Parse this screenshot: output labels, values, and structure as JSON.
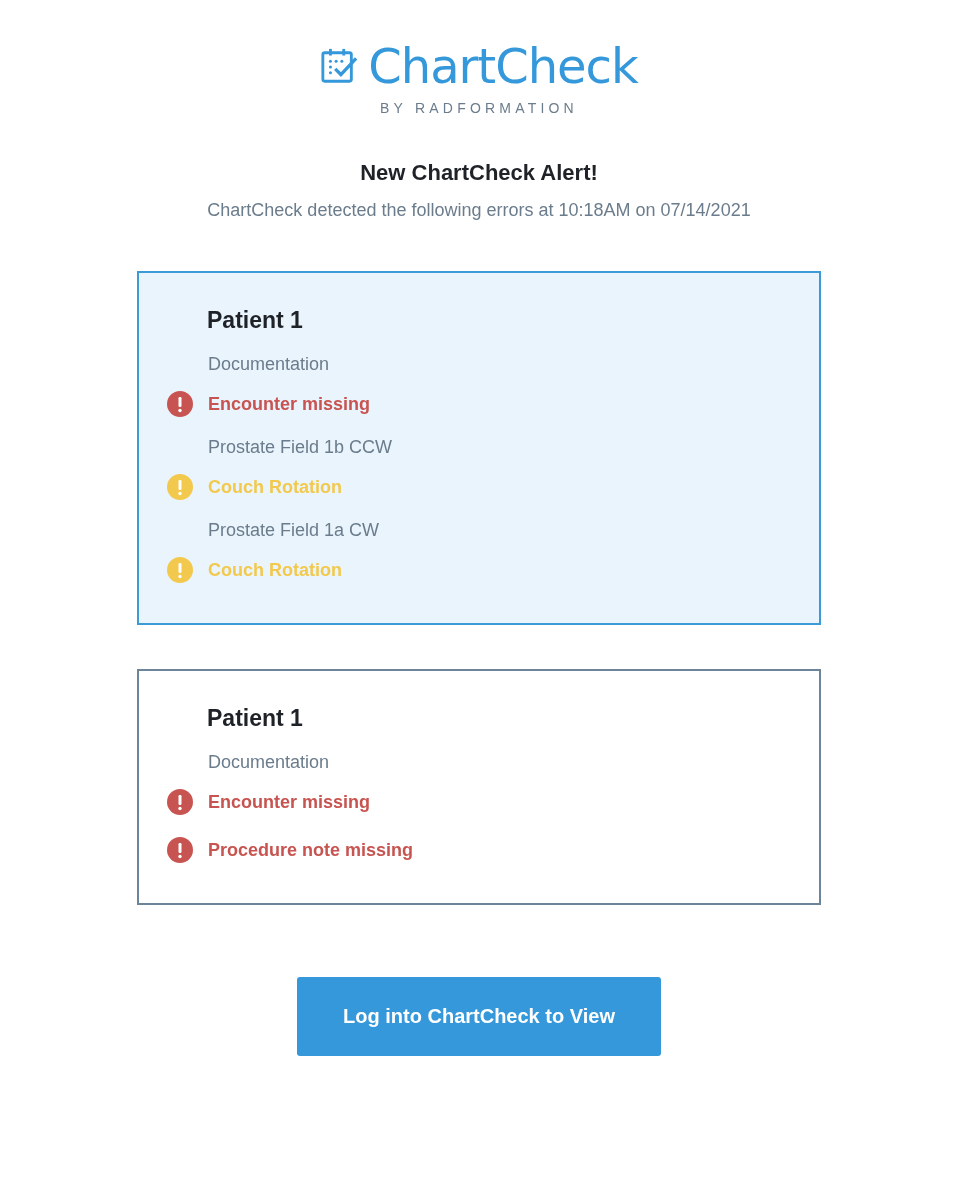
{
  "logo": {
    "name": "ChartCheck",
    "byline": "BY RADFORMATION"
  },
  "heading": "New ChartCheck Alert!",
  "subheading": "ChartCheck detected the following errors at 10:18AM on 07/14/2021",
  "cards": [
    {
      "title": "Patient 1",
      "selected": true,
      "sections": [
        {
          "label": "Documentation",
          "issues": [
            {
              "text": "Encounter missing",
              "kind": "error"
            }
          ]
        },
        {
          "label": "Prostate Field 1b CCW",
          "issues": [
            {
              "text": "Couch Rotation",
              "kind": "warning"
            }
          ]
        },
        {
          "label": "Prostate Field 1a CW",
          "issues": [
            {
              "text": "Couch Rotation",
              "kind": "warning"
            }
          ]
        }
      ]
    },
    {
      "title": "Patient 1",
      "selected": false,
      "sections": [
        {
          "label": "Documentation",
          "issues": [
            {
              "text": "Encounter missing",
              "kind": "error"
            },
            {
              "text": "Procedure note missing",
              "kind": "error"
            }
          ]
        }
      ]
    }
  ],
  "button": "Log into ChartCheck to View"
}
